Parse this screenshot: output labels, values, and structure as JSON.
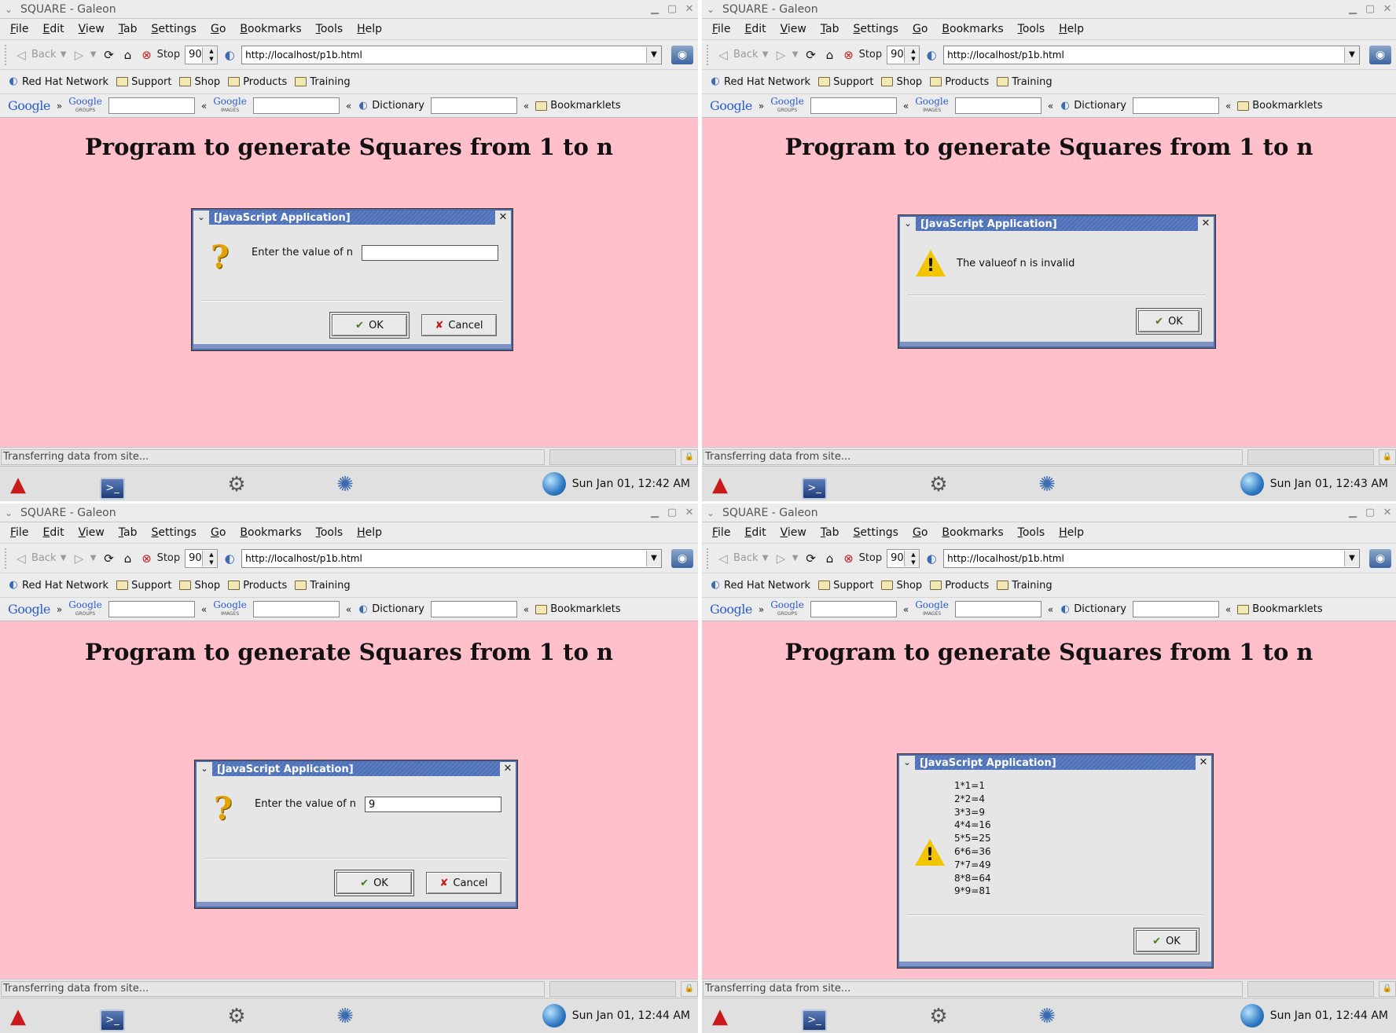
{
  "browser": {
    "window_title": "SQUARE - Galeon",
    "menu": [
      "File",
      "Edit",
      "View",
      "Tab",
      "Settings",
      "Go",
      "Bookmarks",
      "Tools",
      "Help"
    ],
    "toolbar": {
      "back": "Back",
      "stop": "Stop",
      "zoom": "90",
      "url": "http://localhost/p1b.html"
    },
    "bookmarks": [
      {
        "label": "Red Hat Network",
        "icon": "redhat-network-icon"
      },
      {
        "label": "Support",
        "icon": "folder-icon"
      },
      {
        "label": "Shop",
        "icon": "folder-icon"
      },
      {
        "label": "Products",
        "icon": "folder-icon"
      },
      {
        "label": "Training",
        "icon": "folder-icon"
      }
    ],
    "googlebar": {
      "google": "Google",
      "groups": "Google",
      "groups_sub": "GROUPS",
      "images": "Google",
      "images_sub": "IMAGES",
      "dictionary": "Dictionary",
      "bookmarklets": "Bookmarklets"
    },
    "page_heading": "Program to generate Squares from 1 to n",
    "status": "Transferring data from site..."
  },
  "panes": [
    {
      "clock": "Sun Jan 01, 12:42 AM",
      "dialog": {
        "title": "[JavaScript Application]",
        "kind": "prompt",
        "label": "Enter the value of n",
        "value": "",
        "ok": "OK",
        "cancel": "Cancel"
      }
    },
    {
      "clock": "Sun Jan 01, 12:43 AM",
      "dialog": {
        "title": "[JavaScript Application]",
        "kind": "alert",
        "message": "The valueof n is invalid",
        "ok": "OK"
      }
    },
    {
      "clock": "Sun Jan 01, 12:44 AM",
      "dialog": {
        "title": "[JavaScript Application]",
        "kind": "prompt",
        "label": "Enter the value of n",
        "value": "9",
        "ok": "OK",
        "cancel": "Cancel"
      }
    },
    {
      "clock": "Sun Jan 01, 12:44 AM",
      "dialog": {
        "title": "[JavaScript Application]",
        "kind": "alert-list",
        "lines": [
          "1*1=1",
          "2*2=4",
          "3*3=9",
          "4*4=16",
          "5*5=25",
          "6*6=36",
          "7*7=49",
          "8*8=64",
          "9*9=81"
        ],
        "ok": "OK"
      }
    }
  ],
  "icons": {
    "panel": [
      "redhat-menu-icon",
      "terminal-icon",
      "settings-tool-icon",
      "network-globe-icon"
    ],
    "clock_icon": "globe-icon"
  }
}
